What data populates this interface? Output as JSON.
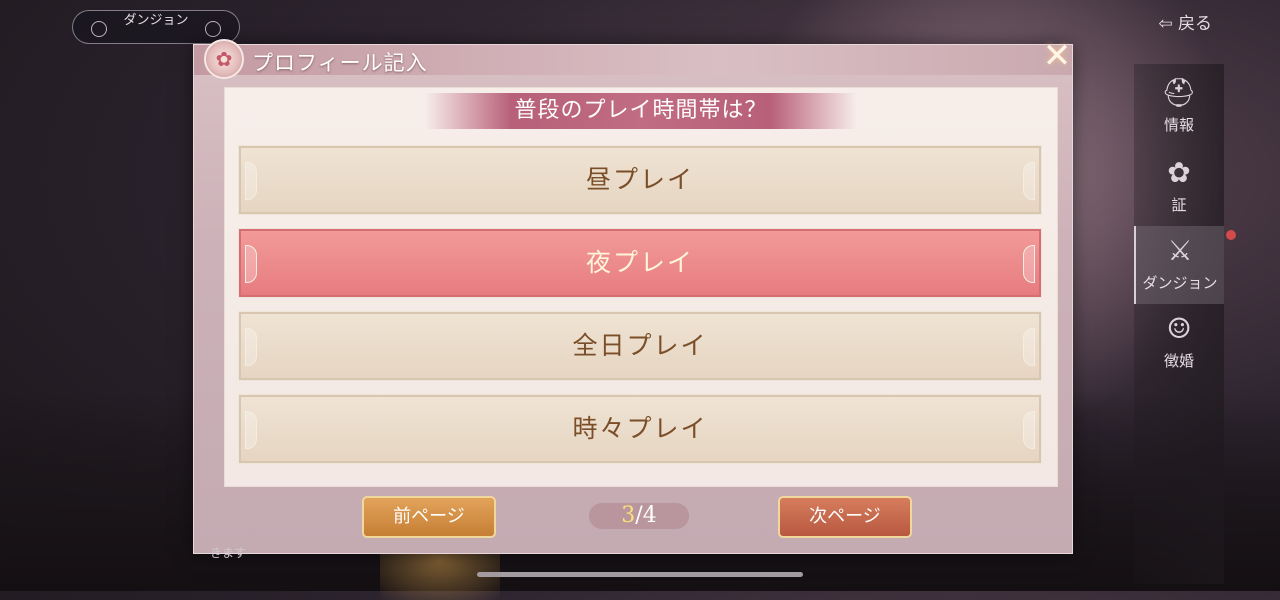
{
  "top_left": {
    "label": "ダンジョン"
  },
  "back": {
    "label": "戻る"
  },
  "side_menu": {
    "items": [
      {
        "label": "情報",
        "icon": "helmet-icon"
      },
      {
        "label": "証",
        "icon": "lotus-icon"
      },
      {
        "label": "ダンジョン",
        "icon": "sword-emblem-icon",
        "active": true,
        "badge": "red-dot"
      },
      {
        "label": "徴婚",
        "icon": "portrait-icon"
      }
    ]
  },
  "dialog": {
    "title": "プロフィール記入",
    "question": "普段のプレイ時間帯は？",
    "options": [
      {
        "label": "昼プレイ",
        "selected": false
      },
      {
        "label": "夜プレイ",
        "selected": true
      },
      {
        "label": "全日プレイ",
        "selected": false
      },
      {
        "label": "時々プレイ",
        "selected": false
      }
    ],
    "prev_label": "前ページ",
    "next_label": "次ページ",
    "page_current": "3",
    "page_total": "/4"
  },
  "footer_hint": "きます",
  "colors": {
    "selected_option": "#e77c80",
    "option": "#e6d5c2",
    "option_text": "#7a4e28",
    "banner": "#b8607a",
    "prev_button": "#c67f35",
    "next_button": "#b85841"
  }
}
